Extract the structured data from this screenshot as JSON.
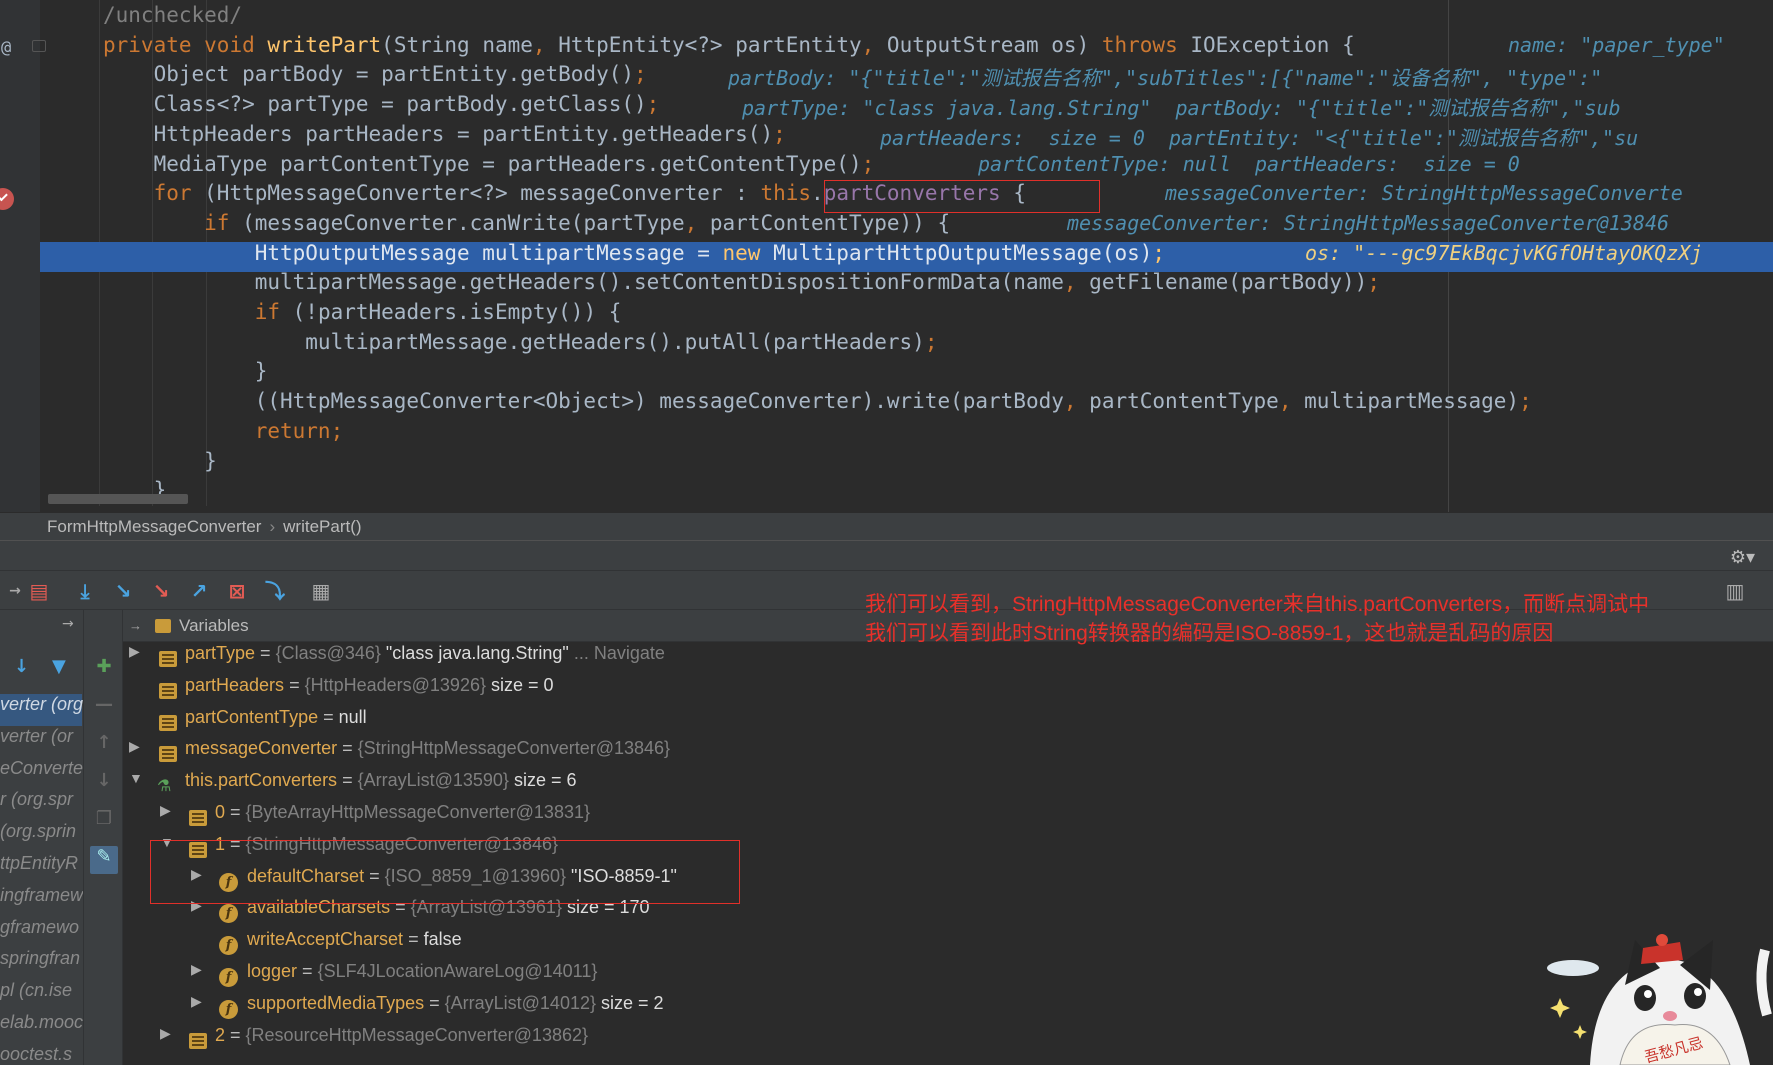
{
  "editor": {
    "lines": [
      {
        "segments": [
          [
            "cm",
            "/unchecked/"
          ]
        ]
      },
      {
        "segments": [
          [
            "k",
            "private "
          ],
          [
            "k",
            "void "
          ],
          [
            "f",
            "writePart"
          ],
          [
            "",
            "(String name"
          ],
          [
            "k",
            ", "
          ],
          [
            "",
            "HttpEntity<?> partEntity"
          ],
          [
            "k",
            ", "
          ],
          [
            "",
            "OutputStream os) "
          ],
          [
            "k",
            "throws "
          ],
          [
            "",
            "IOException {"
          ]
        ],
        "inline": "name: \"paper_type\""
      },
      {
        "segments": [
          [
            "",
            "    Object partBody = partEntity.getBody()"
          ],
          [
            "k",
            ";"
          ]
        ],
        "inline": "partBody: \"{\"title\":\"测试报告名称\",\"subTitles\":[{\"name\":\"设备名称\", \"type\":\""
      },
      {
        "segments": [
          [
            "",
            "    Class<?> partType = partBody.getClass()"
          ],
          [
            "k",
            ";"
          ]
        ],
        "inline": "partType: \"class java.lang.String\"  partBody: \"{\"title\":\"测试报告名称\",\"sub"
      },
      {
        "segments": [
          [
            "",
            "    HttpHeaders partHeaders = partEntity.getHeaders()"
          ],
          [
            "k",
            ";"
          ]
        ],
        "inline": "partHeaders:  size = 0  partEntity: \"<{\"title\":\"测试报告名称\",\"su"
      },
      {
        "segments": [
          [
            "",
            "    MediaType partContentType = partHeaders.getContentType()"
          ],
          [
            "k",
            ";"
          ]
        ],
        "inline": "partContentType: null  partHeaders:  size = 0"
      },
      {
        "segments": [
          [
            "k",
            "    for "
          ],
          [
            "",
            "(HttpMessageConverter<?> messageConverter : "
          ],
          [
            "k",
            "this"
          ],
          [
            "",
            "."
          ],
          [
            "n",
            "partConverters"
          ],
          [
            "",
            " {"
          ]
        ],
        "inline": "messageConverter: StringHttpMessageConverte"
      },
      {
        "segments": [
          [
            "k",
            "        if "
          ],
          [
            "",
            "(messageConverter.canWrite(partType"
          ],
          [
            "k",
            ", "
          ],
          [
            "",
            "partContentType)) {"
          ]
        ],
        "inline": "messageConverter: StringHttpMessageConverter@13846"
      },
      {
        "segments": [
          [
            "",
            "            HttpOutputMessage multipartMessage = "
          ],
          [
            "k",
            "new "
          ],
          [
            "",
            "MultipartHttpOutputMessage(os)"
          ],
          [
            "k",
            ";"
          ]
        ],
        "inline": "os: \"---gc97EkBqcjvKGfOHtayOKQzXj"
      },
      {
        "segments": [
          [
            "",
            "            multipartMessage.getHeaders().setContentDispositionFormData(name"
          ],
          [
            "k",
            ", "
          ],
          [
            "",
            "getFilename(partBody))"
          ],
          [
            "k",
            ";"
          ]
        ]
      },
      {
        "segments": [
          [
            "k",
            "            if "
          ],
          [
            "",
            "(!partHeaders.isEmpty()) {"
          ]
        ]
      },
      {
        "segments": [
          [
            "",
            "                multipartMessage.getHeaders().putAll(partHeaders)"
          ],
          [
            "k",
            ";"
          ]
        ]
      },
      {
        "segments": [
          [
            "",
            "            }"
          ]
        ]
      },
      {
        "segments": [
          [
            "",
            "            ((HttpMessageConverter<Object>) messageConverter).write(partBody"
          ],
          [
            "k",
            ", "
          ],
          [
            "",
            "partContentType"
          ],
          [
            "k",
            ", "
          ],
          [
            "",
            "multipartMessage)"
          ],
          [
            "k",
            ";"
          ]
        ]
      },
      {
        "segments": [
          [
            "k",
            "            return;"
          ]
        ]
      },
      {
        "segments": [
          [
            "",
            "        }"
          ]
        ]
      },
      {
        "segments": [
          [
            "",
            "    }"
          ]
        ]
      }
    ]
  },
  "breadcrumb": {
    "class_name": "FormHttpMessageConverter",
    "separator": "›",
    "method": "writePart()"
  },
  "debugger": {
    "vars_title": "Variables",
    "frames": [
      "verter (org",
      "verter (or",
      "eConverte",
      "r (org.spr",
      "(org.sprin",
      "ttpEntityR",
      "ingframew",
      "gframewo",
      "springfran",
      "pl (cn.ise",
      "elab.mooc",
      "ooctest.s"
    ],
    "variables": [
      {
        "name": "partType",
        "ref": "{Class@346}",
        "value": "\"class java.lang.String\"",
        "extra": "... Navigate"
      },
      {
        "name": "partHeaders",
        "ref": "{HttpHeaders@13926}",
        "value": "size = 0"
      },
      {
        "name": "partContentType",
        "ref": "",
        "value": "null"
      },
      {
        "name": "messageConverter",
        "ref": "{StringHttpMessageConverter@13846}",
        "value": ""
      },
      {
        "name": "this.partConverters",
        "ref": "{ArrayList@13590}",
        "value": "size = 6"
      },
      {
        "name": "0",
        "ref": "{ByteArrayHttpMessageConverter@13831}",
        "value": ""
      },
      {
        "name": "1",
        "ref": "{StringHttpMessageConverter@13846}",
        "value": ""
      },
      {
        "name": "defaultCharset",
        "ref": "{ISO_8859_1@13960}",
        "value": "\"ISO-8859-1\""
      },
      {
        "name": "availableCharsets",
        "ref": "{ArrayList@13961}",
        "value": "size = 170"
      },
      {
        "name": "writeAcceptCharset",
        "ref": "",
        "value": "false"
      },
      {
        "name": "logger",
        "ref": "{SLF4JLocationAwareLog@14011}",
        "value": ""
      },
      {
        "name": "supportedMediaTypes",
        "ref": "{ArrayList@14012}",
        "value": "size = 2"
      },
      {
        "name": "2",
        "ref": "{ResourceHttpMessageConverter@13862}",
        "value": ""
      }
    ]
  },
  "annotation": {
    "line1": "我们可以看到，StringHttpMessageConverter来自this.partConverters，而断点调试中",
    "line2": "我们可以看到此时String转换器的编码是ISO-8859-1，这也就是乱码的原因"
  },
  "colors": {
    "keyword": "#cc7832",
    "method": "#ffc66d",
    "field": "#9876aa",
    "selection": "#2d5fa8",
    "annotation": "#e8302a",
    "var_name": "#e0a950"
  },
  "icons": [
    "gear-icon",
    "show-execution-point-icon",
    "step-over-icon",
    "step-into-icon",
    "force-step-into-icon",
    "step-out-icon",
    "drop-frame-icon",
    "run-to-cursor-icon",
    "evaluate-expression-icon",
    "filter-icon",
    "breakpoint-icon",
    "field-icon",
    "variable-icon",
    "watch-icon"
  ]
}
